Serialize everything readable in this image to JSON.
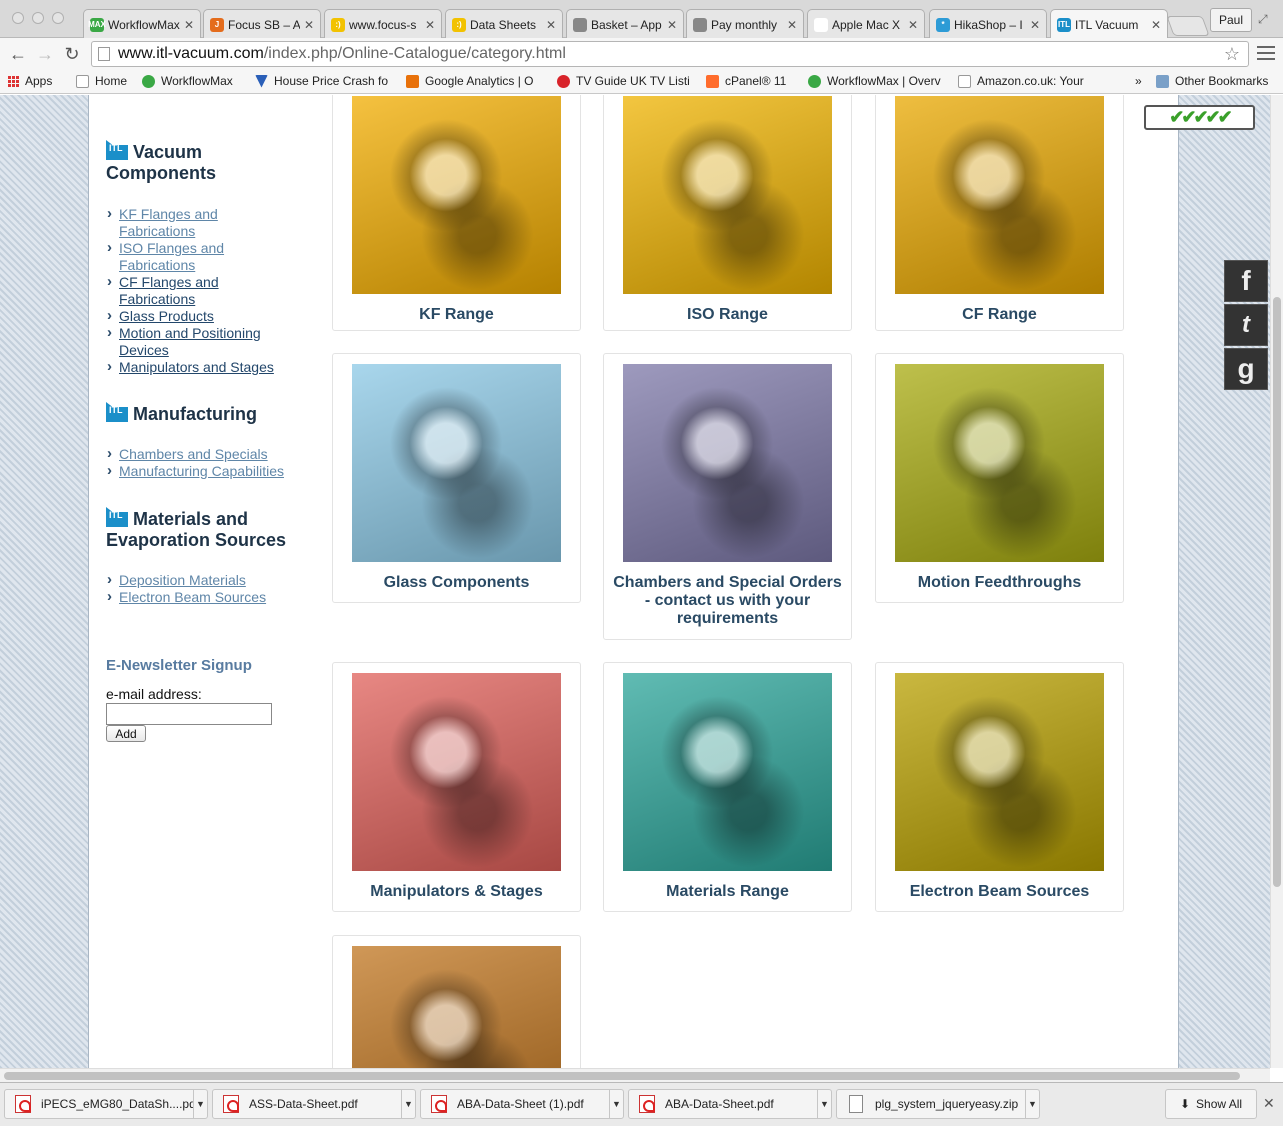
{
  "browser": {
    "tabs": [
      {
        "title": "WorkflowMax",
        "fav_color": "#3aa845",
        "fav_text": "MAX"
      },
      {
        "title": "Focus SB – A",
        "fav_color": "#e46c1c",
        "fav_text": "J"
      },
      {
        "title": "www.focus-s",
        "fav_color": "#f2c200",
        "fav_text": ":)"
      },
      {
        "title": "Data Sheets",
        "fav_color": "#f2c200",
        "fav_text": ":)"
      },
      {
        "title": "Basket – App",
        "fav_color": "#888888",
        "fav_text": ""
      },
      {
        "title": "Pay monthly",
        "fav_color": "#888888",
        "fav_text": ""
      },
      {
        "title": "Apple Mac X",
        "fav_color": "#ffffff",
        "fav_text": ""
      },
      {
        "title": "HikaShop – I",
        "fav_color": "#2d9bd6",
        "fav_text": "*"
      },
      {
        "title": "ITL Vacuum",
        "fav_color": "#1b8fc9",
        "fav_text": "ITL"
      }
    ],
    "profile": "Paul",
    "url_domain": "www.itl-vacuum.com",
    "url_path": "/index.php/Online-Catalogue/category.html",
    "bookmarks": [
      "Apps",
      "Home",
      "WorkflowMax",
      "House Price Crash fo",
      "Google Analytics | O",
      "TV Guide UK TV Listi",
      "cPanel® 11",
      "WorkflowMax | Overv",
      "Amazon.co.uk: Your"
    ],
    "bookmarks_more": "»",
    "other_bookmarks": "Other Bookmarks"
  },
  "sidebar": {
    "logo_text": "ITL",
    "sections": [
      {
        "title_line1": "Vacuum",
        "title_line2": "Components",
        "items": [
          "KF Flanges and Fabrications",
          "ISO Flanges and Fabrications",
          "CF Flanges and Fabrications",
          "Glass Products",
          "Motion and Positioning Devices",
          "Manipulators and Stages"
        ]
      },
      {
        "title_line1": "Manufacturing",
        "title_line2": "",
        "items": [
          "Chambers and Specials",
          "Manufacturing Capabilities"
        ]
      },
      {
        "title_line1": "Materials and",
        "title_line2": "Evaporation Sources",
        "items": [
          "Deposition Materials",
          "Electron Beam Sources"
        ]
      }
    ],
    "newsletter": {
      "title": "E-Newsletter Signup",
      "label": "e-mail address:",
      "value": "",
      "button": "Add"
    }
  },
  "products": [
    {
      "title": "KF Range",
      "color": "#f2ad00"
    },
    {
      "title": "ISO Range",
      "color": "#efb300"
    },
    {
      "title": "CF Range",
      "color": "#e9a800"
    },
    {
      "title": "Glass Components",
      "color": "#8cc9e6"
    },
    {
      "title": "Chambers and Special Orders - contact us with your requirements",
      "color": "#7d78a8"
    },
    {
      "title": "Motion Feedthroughs",
      "color": "#a8ab10"
    },
    {
      "title": "Manipulators & Stages",
      "color": "#e0605a"
    },
    {
      "title": "Materials Range",
      "color": "#2ba59a"
    },
    {
      "title": "Electron Beam Sources",
      "color": "#b8a000"
    },
    {
      "title": "",
      "color": "#c0751f"
    }
  ],
  "rating_marks": "✔✔✔✔✔",
  "social": [
    "f",
    "t",
    "g"
  ],
  "downloads": [
    "iPECS_eMG80_DataSh....pdf",
    "ASS-Data-Sheet.pdf",
    "ABA-Data-Sheet (1).pdf",
    "ABA-Data-Sheet.pdf",
    "plg_system_jqueryeasy.zip"
  ],
  "show_all": "Show All"
}
